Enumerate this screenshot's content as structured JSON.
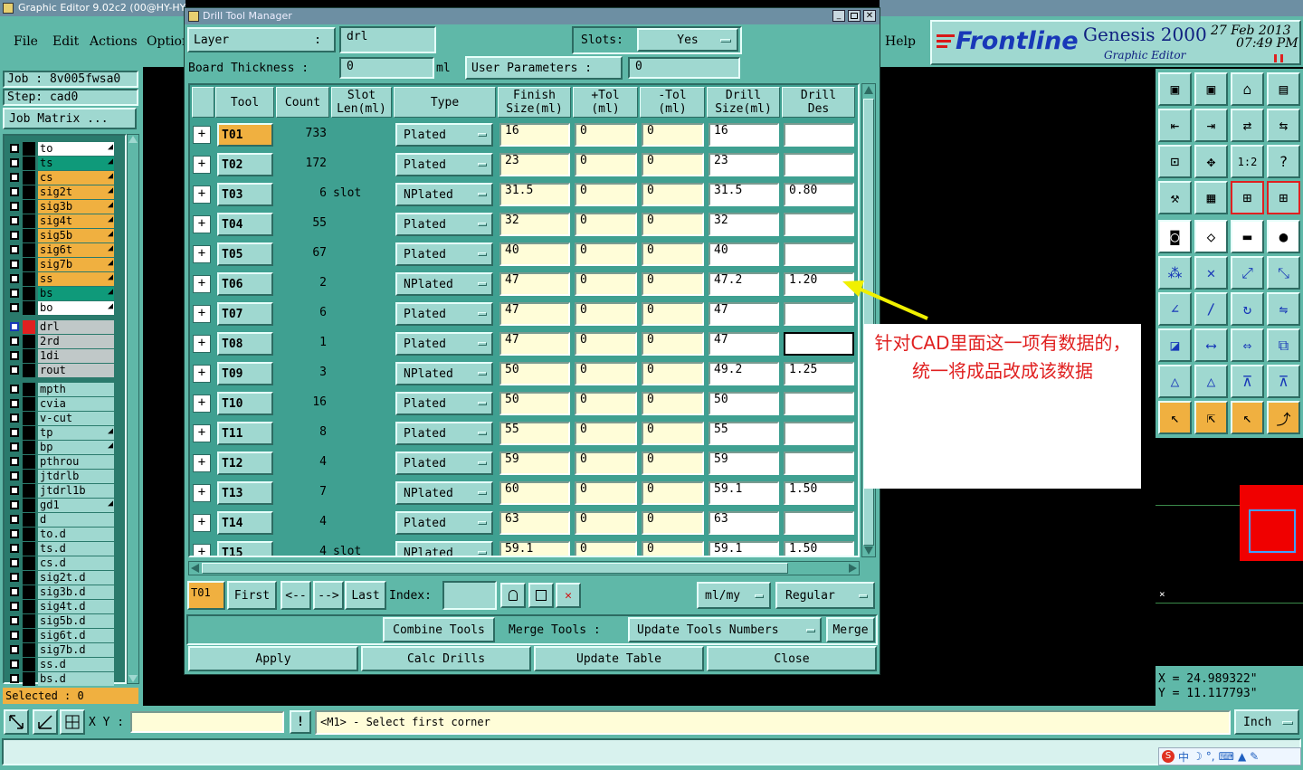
{
  "bg_window": {
    "title": "Graphic Editor 9.02c2 (00@HY-HY",
    "menu": [
      "File",
      "Edit",
      "Actions",
      "Optior"
    ],
    "help": "Help"
  },
  "brand": {
    "logo": "Frontline",
    "product": "Genesis 2000",
    "subtitle": "Graphic Editor",
    "date": "27 Feb 2013",
    "time": "07:49 PM"
  },
  "job": {
    "job": "Job : 8v005fwsa0",
    "step": "Step: cad0",
    "matrix": "Job Matrix ..."
  },
  "layers_main": [
    {
      "name": "to",
      "color": "#ffffff",
      "mark": true
    },
    {
      "name": "ts",
      "color": "#0f9a7a",
      "mark": true
    },
    {
      "name": "cs",
      "color": "#f0b040",
      "mark": true
    },
    {
      "name": "sig2t",
      "color": "#f0b040",
      "mark": true
    },
    {
      "name": "sig3b",
      "color": "#f0b040",
      "mark": true
    },
    {
      "name": "sig4t",
      "color": "#f0b040",
      "mark": true
    },
    {
      "name": "sig5b",
      "color": "#f0b040",
      "mark": true
    },
    {
      "name": "sig6t",
      "color": "#f0b040",
      "mark": true
    },
    {
      "name": "sig7b",
      "color": "#f0b040",
      "mark": true
    },
    {
      "name": "ss",
      "color": "#f0b040",
      "mark": true
    },
    {
      "name": "bs",
      "color": "#0f9a7a",
      "mark": true
    },
    {
      "name": "bo",
      "color": "#ffffff",
      "mark": true
    }
  ],
  "layers_drill": [
    {
      "name": "drl",
      "color": "#c0c8c8"
    },
    {
      "name": "2rd",
      "color": "#c0c8c8"
    },
    {
      "name": "1di",
      "color": "#c0c8c8"
    },
    {
      "name": "rout",
      "color": "#c0c8c8"
    }
  ],
  "layers_misc": [
    {
      "name": "mpth",
      "mark": false
    },
    {
      "name": "cvia",
      "mark": false
    },
    {
      "name": "v-cut",
      "mark": false
    },
    {
      "name": "tp",
      "mark": true
    },
    {
      "name": "bp",
      "mark": true
    },
    {
      "name": "pthrou",
      "mark": false
    },
    {
      "name": "jtdrlb",
      "mark": false
    },
    {
      "name": "jtdrl1b",
      "mark": false
    },
    {
      "name": "gd1",
      "mark": true
    },
    {
      "name": "d",
      "mark": false
    },
    {
      "name": "to.d",
      "mark": false
    },
    {
      "name": "ts.d",
      "mark": false
    },
    {
      "name": "cs.d",
      "mark": false
    },
    {
      "name": "sig2t.d",
      "mark": false
    },
    {
      "name": "sig3b.d",
      "mark": false
    },
    {
      "name": "sig4t.d",
      "mark": false
    },
    {
      "name": "sig5b.d",
      "mark": false
    },
    {
      "name": "sig6t.d",
      "mark": false
    },
    {
      "name": "sig7b.d",
      "mark": false
    },
    {
      "name": "ss.d",
      "mark": false
    },
    {
      "name": "bs.d",
      "mark": false
    }
  ],
  "selected": "Selected : 0",
  "dialog": {
    "title": "Drill Tool Manager",
    "layer_label": "Layer",
    "layer_colon": ":",
    "layer_value": "drl",
    "slots_label": "Slots:",
    "slots_value": "Yes",
    "board_label": "Board Thickness :",
    "board_value": "0",
    "board_unit": "ml",
    "user_params": "User Parameters :",
    "user_value": "0",
    "headers": [
      "Tool",
      "Count",
      "Slot\nLen(ml)",
      "Type",
      "Finish\nSize(ml)",
      "+Tol\n(ml)",
      "-Tol\n(ml)",
      "Drill\nSize(ml)",
      "Drill\nDes"
    ],
    "rows": [
      {
        "tool": "T01",
        "count": "733",
        "slot": "",
        "type": "Plated",
        "finish": "16",
        "ptol": "0",
        "mtol": "0",
        "drill": "16",
        "des": ""
      },
      {
        "tool": "T02",
        "count": "172",
        "slot": "",
        "type": "Plated",
        "finish": "23",
        "ptol": "0",
        "mtol": "0",
        "drill": "23",
        "des": ""
      },
      {
        "tool": "T03",
        "count": "6",
        "slot": "slot",
        "type": "NPlated",
        "finish": "31.5",
        "ptol": "0",
        "mtol": "0",
        "drill": "31.5",
        "des": "0.80"
      },
      {
        "tool": "T04",
        "count": "55",
        "slot": "",
        "type": "Plated",
        "finish": "32",
        "ptol": "0",
        "mtol": "0",
        "drill": "32",
        "des": ""
      },
      {
        "tool": "T05",
        "count": "67",
        "slot": "",
        "type": "Plated",
        "finish": "40",
        "ptol": "0",
        "mtol": "0",
        "drill": "40",
        "des": ""
      },
      {
        "tool": "T06",
        "count": "2",
        "slot": "",
        "type": "NPlated",
        "finish": "47",
        "ptol": "0",
        "mtol": "0",
        "drill": "47.2",
        "des": "1.20"
      },
      {
        "tool": "T07",
        "count": "6",
        "slot": "",
        "type": "Plated",
        "finish": "47",
        "ptol": "0",
        "mtol": "0",
        "drill": "47",
        "des": ""
      },
      {
        "tool": "T08",
        "count": "1",
        "slot": "",
        "type": "Plated",
        "finish": "47",
        "ptol": "0",
        "mtol": "0",
        "drill": "47",
        "des": ""
      },
      {
        "tool": "T09",
        "count": "3",
        "slot": "",
        "type": "NPlated",
        "finish": "50",
        "ptol": "0",
        "mtol": "0",
        "drill": "49.2",
        "des": "1.25"
      },
      {
        "tool": "T10",
        "count": "16",
        "slot": "",
        "type": "Plated",
        "finish": "50",
        "ptol": "0",
        "mtol": "0",
        "drill": "50",
        "des": ""
      },
      {
        "tool": "T11",
        "count": "8",
        "slot": "",
        "type": "Plated",
        "finish": "55",
        "ptol": "0",
        "mtol": "0",
        "drill": "55",
        "des": ""
      },
      {
        "tool": "T12",
        "count": "4",
        "slot": "",
        "type": "Plated",
        "finish": "59",
        "ptol": "0",
        "mtol": "0",
        "drill": "59",
        "des": ""
      },
      {
        "tool": "T13",
        "count": "7",
        "slot": "",
        "type": "NPlated",
        "finish": "60",
        "ptol": "0",
        "mtol": "0",
        "drill": "59.1",
        "des": "1.50"
      },
      {
        "tool": "T14",
        "count": "4",
        "slot": "",
        "type": "Plated",
        "finish": "63",
        "ptol": "0",
        "mtol": "0",
        "drill": "63",
        "des": ""
      },
      {
        "tool": "T15",
        "count": "4",
        "slot": "slot",
        "type": "NPlated",
        "finish": "59.1",
        "ptol": "0",
        "mtol": "0",
        "drill": "59.1",
        "des": "1.50"
      }
    ],
    "nav": {
      "current": "T01",
      "first": "First",
      "prev": "<--",
      "next": "-->",
      "last": "Last",
      "index": "Index:",
      "units": "ml/my",
      "mode": "Regular"
    },
    "actions": {
      "combine": "Combine Tools",
      "merge_tools": "Merge Tools :",
      "update_nums": "Update Tools Numbers",
      "merge": "Merge"
    },
    "bottom": {
      "apply": "Apply",
      "calc": "Calc Drills",
      "update": "Update Table",
      "close": "Close"
    }
  },
  "annotation": "针对CAD里面这一项有数据的，统一将成品改成该数据",
  "coords": {
    "x": "X  =  24.989322\"",
    "y": "Y  =  11.117793\""
  },
  "status": {
    "xy_label": "X Y :",
    "message": "<M1> - Select first corner",
    "unit": "Inch"
  },
  "tray": "中"
}
